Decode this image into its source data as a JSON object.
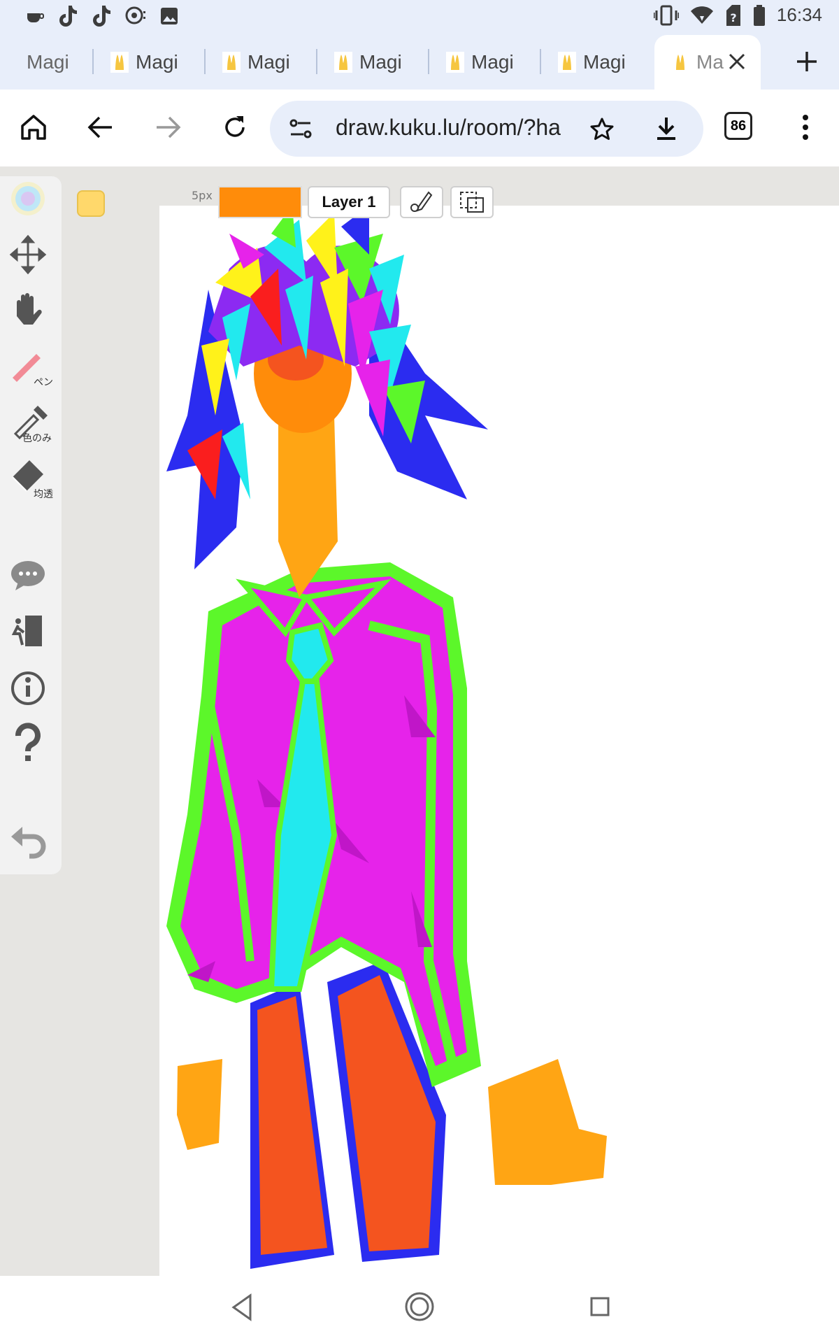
{
  "status_bar": {
    "time": "16:34",
    "left_icons": [
      "cup-icon",
      "tiktok-icon",
      "tiktok-icon",
      "podcast-icon",
      "image-icon"
    ],
    "right_icons": [
      "vibrate-icon",
      "wifi-icon",
      "sim-unknown-icon",
      "battery-icon"
    ]
  },
  "tabs": [
    {
      "label": "Magi",
      "favicon": "bunny-icon"
    },
    {
      "label": "Magi",
      "favicon": "bunny-icon"
    },
    {
      "label": "Magi",
      "favicon": "bunny-icon"
    },
    {
      "label": "Magi",
      "favicon": "bunny-icon"
    },
    {
      "label": "Magi",
      "favicon": "bunny-icon"
    },
    {
      "label": "Magi",
      "favicon": "bunny-icon"
    },
    {
      "label": "Ma",
      "favicon": "bunny-icon",
      "active": true
    }
  ],
  "toolbar": {
    "url": "draw.kuku.lu/room/?ha",
    "tab_count": "86"
  },
  "app": {
    "brush_size": "5px",
    "current_color": "#ff8c0a",
    "secondary_color": "#ffd86b",
    "layer_label": "Layer 1",
    "tools": {
      "pen_label": "ペン",
      "color_only_label": "色のみ",
      "eraser_label": "均透"
    }
  }
}
